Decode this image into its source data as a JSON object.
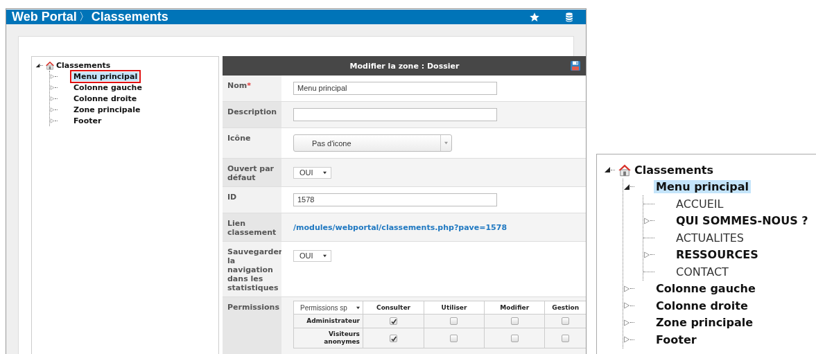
{
  "window": {
    "breadcrumb": [
      {
        "label": "Web Portal"
      },
      {
        "label": "Classements"
      }
    ],
    "separator": "〉"
  },
  "tree": {
    "label": "Classements",
    "kind": "root",
    "expanded": true,
    "selected": false,
    "outlined": false,
    "children": [
      {
        "label": "Menu principal",
        "kind": "folder",
        "expanded": false,
        "selected": true,
        "outlined": true
      },
      {
        "label": "Colonne gauche",
        "kind": "folder",
        "expanded": false,
        "selected": false,
        "outlined": false
      },
      {
        "label": "Colonne droite",
        "kind": "folder",
        "expanded": false,
        "selected": false,
        "outlined": false
      },
      {
        "label": "Zone principale",
        "kind": "folder",
        "expanded": false,
        "selected": false,
        "outlined": false
      },
      {
        "label": "Footer",
        "kind": "folder",
        "expanded": false,
        "selected": false,
        "outlined": false
      }
    ]
  },
  "panel": {
    "title": "Modifier la zone : Dossier",
    "required_mark": "*",
    "fields": [
      {
        "label": "Nom",
        "required": true,
        "kind": "text",
        "value": "Menu principal"
      },
      {
        "label": "Description",
        "required": false,
        "kind": "text"
      },
      {
        "label": "Icône",
        "required": false,
        "kind": "combo",
        "value": "Pas d'icone"
      },
      {
        "label": "Ouvert par défaut",
        "required": false,
        "kind": "select",
        "value": "OUI"
      },
      {
        "label": "ID",
        "required": false,
        "kind": "text",
        "value": "1578"
      },
      {
        "label": "Lien classement",
        "required": false,
        "kind": "link",
        "value": "/modules/webportal/classements.php?pave=1578"
      },
      {
        "label": "Sauvegarder la navigation dans les statistiques",
        "required": false,
        "kind": "select",
        "value": "OUI"
      },
      {
        "label": "Permissions",
        "required": false,
        "kind": "permissions"
      }
    ],
    "permissions": {
      "filter": "Permissions sp",
      "columns": [
        "Consulter",
        "Utiliser",
        "Modifier",
        "Gestion"
      ],
      "rows": [
        {
          "label": "Administrateur",
          "checks": [
            true,
            false,
            false,
            false
          ]
        },
        {
          "label": "Visiteurs anonymes",
          "checks": [
            true,
            false,
            false,
            false
          ]
        }
      ]
    }
  },
  "zoom_inset": {
    "tree": {
      "label": "Classements",
      "kind": "root",
      "expanded": true,
      "selected": false,
      "children": [
        {
          "label": "Menu principal",
          "kind": "folder",
          "expanded": true,
          "selected": true,
          "children": [
            {
              "label": "ACCUEIL",
              "kind": "page",
              "selected": false
            },
            {
              "label": "QUI SOMMES-NOUS ?",
              "kind": "folder",
              "expanded": false,
              "selected": false
            },
            {
              "label": "ACTUALITES",
              "kind": "page",
              "selected": false
            },
            {
              "label": "RESSOURCES",
              "kind": "folder",
              "expanded": false,
              "selected": false
            },
            {
              "label": "CONTACT",
              "kind": "page",
              "selected": false
            }
          ]
        },
        {
          "label": "Colonne gauche",
          "kind": "folder",
          "expanded": false,
          "selected": false
        },
        {
          "label": "Colonne droite",
          "kind": "folder",
          "expanded": false,
          "selected": false
        },
        {
          "label": "Zone principale",
          "kind": "folder",
          "expanded": false,
          "selected": false
        },
        {
          "label": "Footer",
          "kind": "folder",
          "expanded": false,
          "selected": false
        }
      ]
    }
  }
}
